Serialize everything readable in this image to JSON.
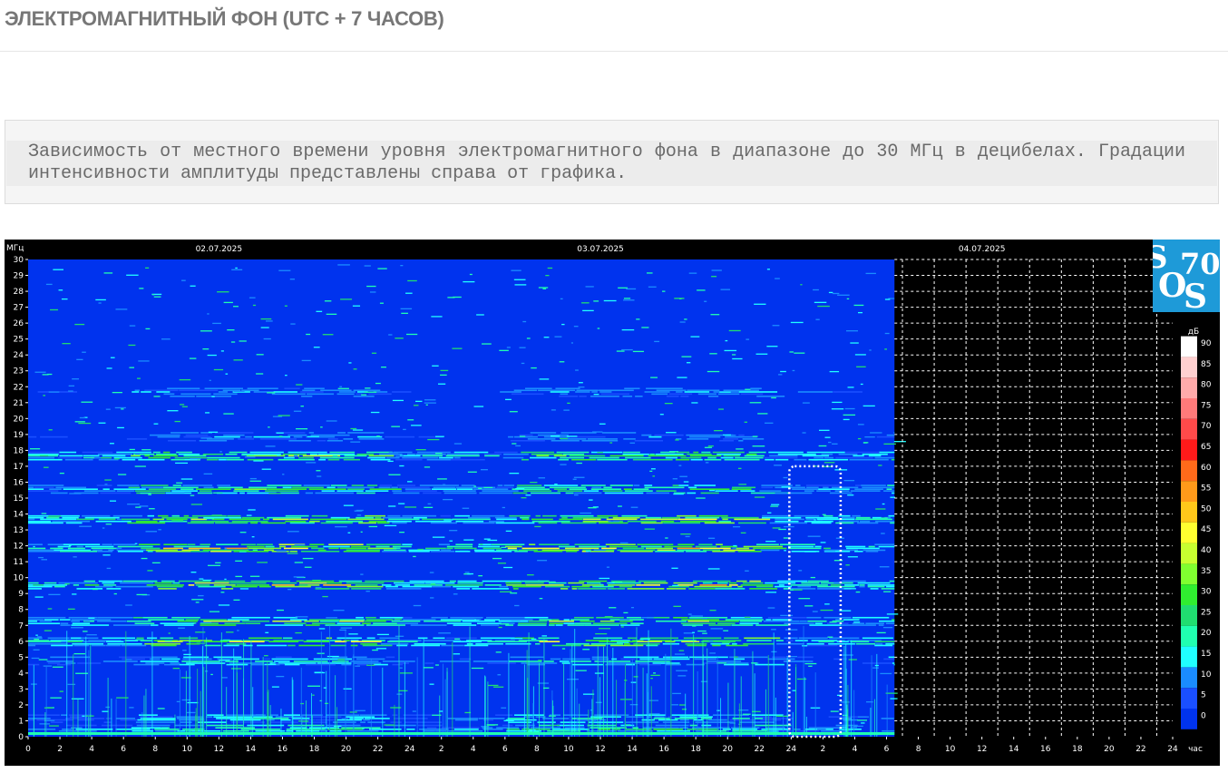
{
  "page": {
    "title": "ЭЛЕКТРОМАГНИТНЫЙ ФОН (UTC + 7 ЧАСОВ)",
    "description": "Зависимость от местного времени уровня электромагнитного фона в диапазоне до 30 МГц в децибелах. Градации интенсивности амплитуды представлены справа от графика."
  },
  "logo": {
    "text_s1": "S",
    "text_70": "70",
    "text_o": "O",
    "text_s2": "S"
  },
  "colors": {
    "background": "#000000",
    "spectrum_base": "#0033ee",
    "grid": "#ffffff",
    "highlight_box": "#ffffff",
    "logo": "#1e9ad8"
  },
  "chart_data": {
    "type": "heatmap",
    "y_unit_label": "МГц",
    "x_unit_label": "час",
    "scale_unit_label": "дБ",
    "ylim": [
      0,
      30
    ],
    "y_ticks": [
      0,
      1,
      2,
      3,
      4,
      5,
      6,
      7,
      8,
      9,
      10,
      11,
      12,
      13,
      14,
      15,
      16,
      17,
      18,
      19,
      20,
      21,
      22,
      23,
      24,
      25,
      26,
      27,
      28,
      29,
      30
    ],
    "x_tick_labels": [
      "0",
      "2",
      "4",
      "6",
      "8",
      "10",
      "12",
      "14",
      "16",
      "18",
      "20",
      "22",
      "24",
      "2",
      "4",
      "6",
      "8",
      "10",
      "12",
      "14",
      "16",
      "18",
      "20",
      "22",
      "24",
      "2",
      "4",
      "6",
      "8",
      "10",
      "12",
      "14",
      "16",
      "18",
      "20",
      "22",
      "24"
    ],
    "x_hours_total": 72,
    "data_end_hour": 54.5,
    "dates": [
      {
        "label": "02.07.2025",
        "hour": 12
      },
      {
        "label": "03.07.2025",
        "hour": 36
      },
      {
        "label": "04.07.2025",
        "hour": 60
      }
    ],
    "highlight_hours": [
      48,
      51
    ],
    "highlight_mhz": [
      0,
      17
    ],
    "scale": [
      {
        "db": "90",
        "color": "#ffffff"
      },
      {
        "db": "85",
        "color": "#ffd0d0"
      },
      {
        "db": "80",
        "color": "#ffaaaa"
      },
      {
        "db": "75",
        "color": "#ff7a7a"
      },
      {
        "db": "70",
        "color": "#ff4a4a"
      },
      {
        "db": "65",
        "color": "#ff1a1a"
      },
      {
        "db": "60",
        "color": "#ff6a1a"
      },
      {
        "db": "55",
        "color": "#ff9a1a"
      },
      {
        "db": "50",
        "color": "#ffc81a"
      },
      {
        "db": "45",
        "color": "#ffff30"
      },
      {
        "db": "40",
        "color": "#c8ff30"
      },
      {
        "db": "35",
        "color": "#80ff30"
      },
      {
        "db": "30",
        "color": "#30ee30"
      },
      {
        "db": "25",
        "color": "#20dd70"
      },
      {
        "db": "20",
        "color": "#20ffb0"
      },
      {
        "db": "15",
        "color": "#20ffff"
      },
      {
        "db": "10",
        "color": "#1a8cff"
      },
      {
        "db": "5",
        "color": "#1a4fff"
      },
      {
        "db": "0",
        "color": "#0033ee"
      }
    ],
    "bands": [
      {
        "mhz": 0.5,
        "level": 25
      },
      {
        "mhz": 1.2,
        "level": 20
      },
      {
        "mhz": 4.8,
        "level": 20
      },
      {
        "mhz": 6.0,
        "level": 40
      },
      {
        "mhz": 7.3,
        "level": 35
      },
      {
        "mhz": 9.6,
        "level": 45
      },
      {
        "mhz": 11.9,
        "level": 45
      },
      {
        "mhz": 13.7,
        "level": 40
      },
      {
        "mhz": 15.6,
        "level": 30
      },
      {
        "mhz": 17.7,
        "level": 35
      },
      {
        "mhz": 18.9,
        "level": 15
      },
      {
        "mhz": 21.7,
        "level": 15
      }
    ]
  }
}
